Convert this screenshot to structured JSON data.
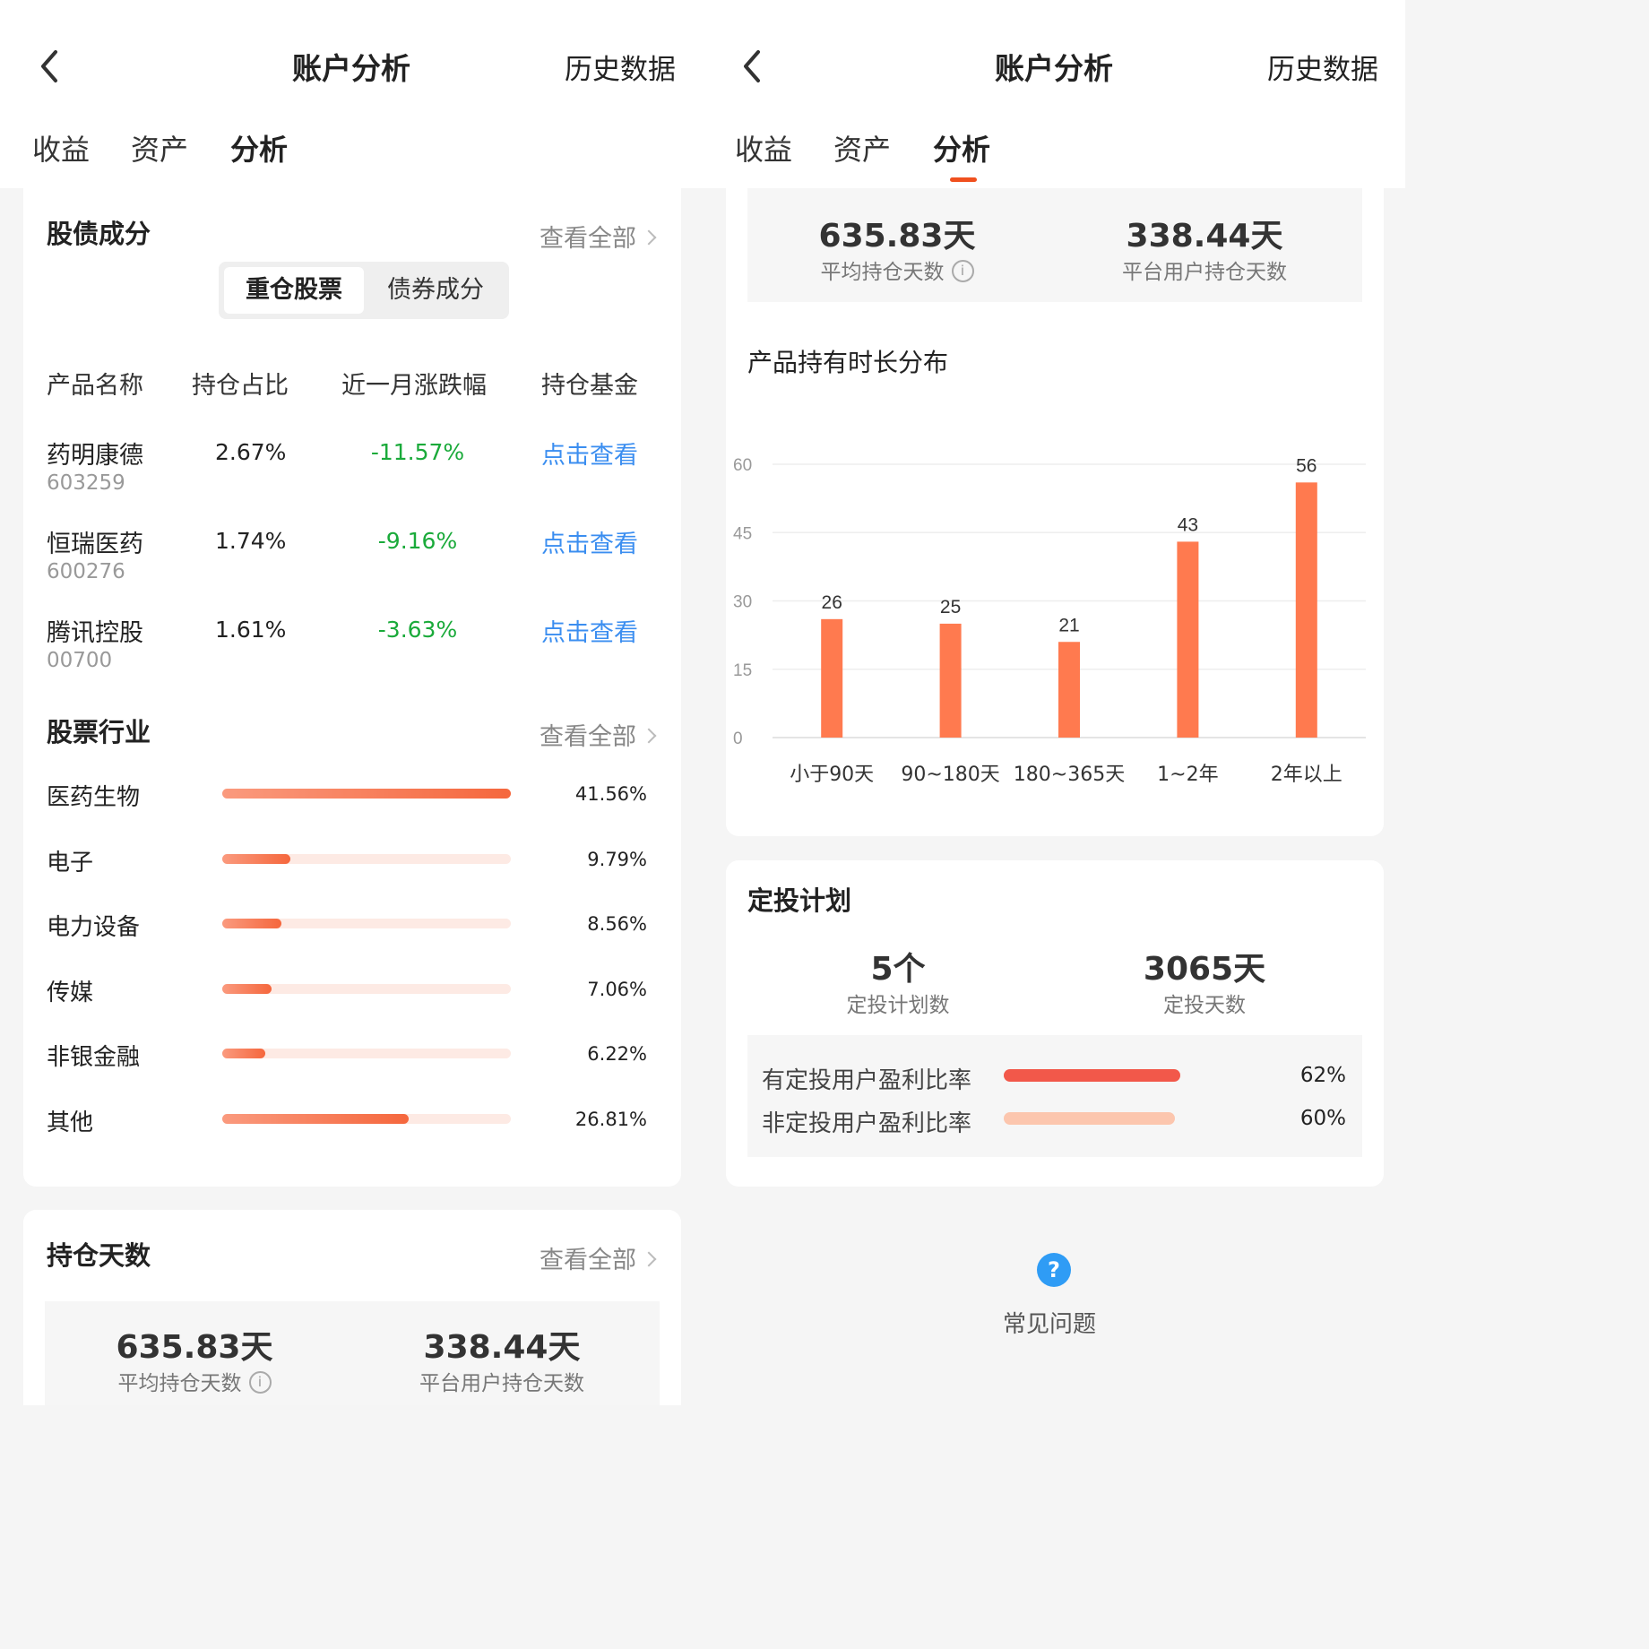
{
  "header": {
    "title": "账户分析",
    "right_link": "历史数据"
  },
  "tabs": [
    {
      "label": "收益"
    },
    {
      "label": "资产"
    },
    {
      "label": "分析"
    }
  ],
  "active_tab": "分析",
  "accent_color": "#f0501e",
  "holdings": {
    "title": "股债成分",
    "view_all": "查看全部",
    "segments": [
      "重仓股票",
      "债券成分"
    ],
    "columns": [
      "产品名称",
      "持仓占比",
      "近一月涨跌幅",
      "持仓基金"
    ],
    "rows": [
      {
        "name": "药明康德",
        "code": "603259",
        "ratio": "2.67%",
        "change": "-11.57%",
        "link": "点击查看"
      },
      {
        "name": "恒瑞医药",
        "code": "600276",
        "ratio": "1.74%",
        "change": "-9.16%",
        "link": "点击查看"
      },
      {
        "name": "腾讯控股",
        "code": "00700",
        "ratio": "1.61%",
        "change": "-3.63%",
        "link": "点击查看"
      }
    ]
  },
  "industry": {
    "title": "股票行业",
    "view_all": "查看全部",
    "items": [
      {
        "name": "医药生物",
        "pct_label": "41.56%",
        "bar_fraction": 1.0
      },
      {
        "name": "电子",
        "pct_label": "9.79%",
        "bar_fraction": 0.235
      },
      {
        "name": "电力设备",
        "pct_label": "8.56%",
        "bar_fraction": 0.206
      },
      {
        "name": "传媒",
        "pct_label": "7.06%",
        "bar_fraction": 0.17
      },
      {
        "name": "非银金融",
        "pct_label": "6.22%",
        "bar_fraction": 0.15
      },
      {
        "name": "其他",
        "pct_label": "26.81%",
        "bar_fraction": 0.645
      }
    ]
  },
  "holding_days": {
    "title": "持仓天数",
    "view_all": "查看全部",
    "avg_value": "635.83天",
    "avg_label": "平均持仓天数",
    "platform_value": "338.44天",
    "platform_label": "平台用户持仓天数",
    "info_icon": "i"
  },
  "distribution": {
    "title": "产品持有时长分布"
  },
  "chart_data": {
    "type": "bar",
    "title": "产品持有时长分布",
    "categories": [
      "小于90天",
      "90~180天",
      "180~365天",
      "1~2年",
      "2年以上"
    ],
    "values": [
      26,
      25,
      21,
      43,
      56
    ],
    "ylim": [
      0,
      60
    ],
    "yticks": [
      0,
      15,
      30,
      45,
      60
    ],
    "grid": true,
    "bar_color": "#ff7a4f"
  },
  "plan": {
    "title": "定投计划",
    "count_value": "5个",
    "count_label": "定投计划数",
    "days_value": "3065天",
    "days_label": "定投天数",
    "rates": [
      {
        "label": "有定投用户盈利比率",
        "value": "62%",
        "fraction": 0.62,
        "color": "#f2584a"
      },
      {
        "label": "非定投用户盈利比率",
        "value": "60%",
        "fraction": 0.6,
        "color": "#fcc6ae"
      }
    ]
  },
  "faq": {
    "label": "常见问题",
    "icon": "question-icon",
    "icon_glyph": "?"
  }
}
